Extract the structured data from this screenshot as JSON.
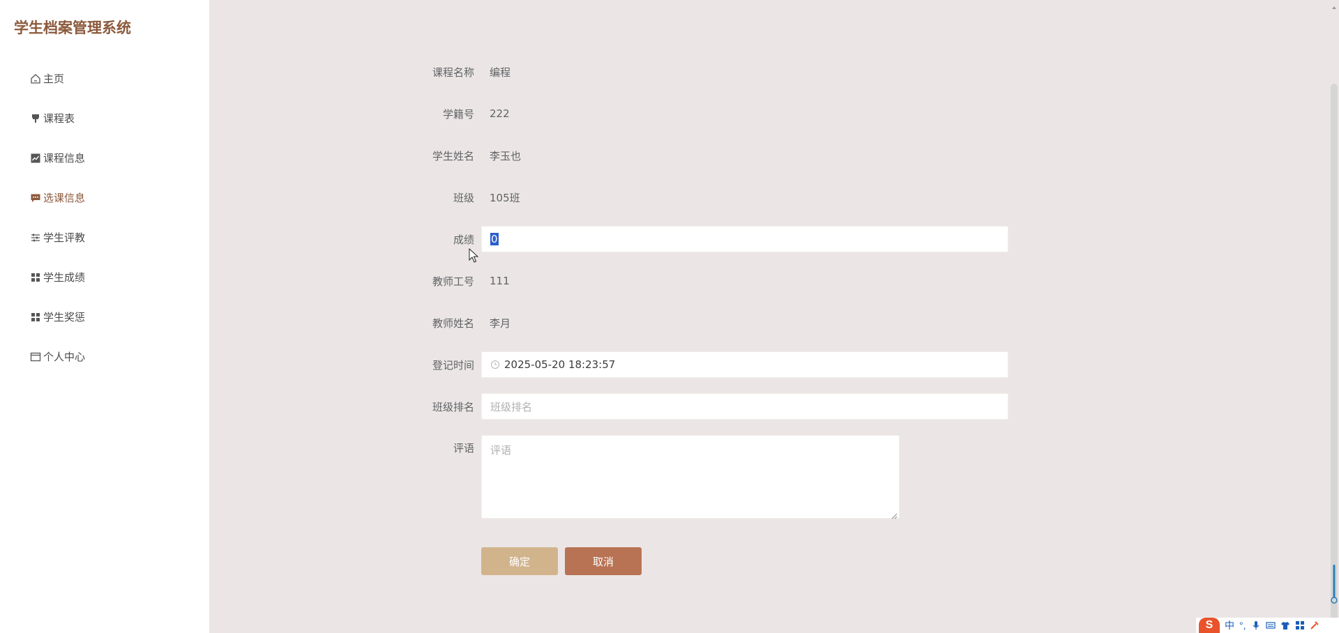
{
  "app": {
    "title": "学生档案管理系统"
  },
  "sidebar": {
    "items": [
      {
        "label": "主页",
        "icon": "home-icon"
      },
      {
        "label": "课程表",
        "icon": "brush-icon"
      },
      {
        "label": "课程信息",
        "icon": "chart-icon"
      },
      {
        "label": "选课信息",
        "icon": "chat-icon",
        "active": true
      },
      {
        "label": "学生评教",
        "icon": "sliders-icon"
      },
      {
        "label": "学生成绩",
        "icon": "grid-icon"
      },
      {
        "label": "学生奖惩",
        "icon": "grid-icon"
      },
      {
        "label": "个人中心",
        "icon": "window-icon"
      }
    ]
  },
  "form": {
    "course_name": {
      "label": "课程名称",
      "value": "编程"
    },
    "student_id": {
      "label": "学籍号",
      "value": "222"
    },
    "student_name": {
      "label": "学生姓名",
      "value": "李玉也"
    },
    "class": {
      "label": "班级",
      "value": "105班"
    },
    "score": {
      "label": "成绩",
      "value": "0"
    },
    "teacher_id": {
      "label": "教师工号",
      "value": "111"
    },
    "teacher_name": {
      "label": "教师姓名",
      "value": "李月"
    },
    "register_time": {
      "label": "登记时间",
      "value": "2025-05-20 18:23:57"
    },
    "class_rank": {
      "label": "班级排名",
      "placeholder": "班级排名"
    },
    "comment": {
      "label": "评语",
      "placeholder": "评语"
    }
  },
  "buttons": {
    "confirm": "确定",
    "cancel": "取消"
  },
  "ime": {
    "lang": "中",
    "punct": "°,"
  },
  "colors": {
    "brand": "#8b5a3c",
    "confirm_button": "#d2b48c",
    "cancel_button": "#b87354",
    "page_bg": "#ebe6e5"
  }
}
